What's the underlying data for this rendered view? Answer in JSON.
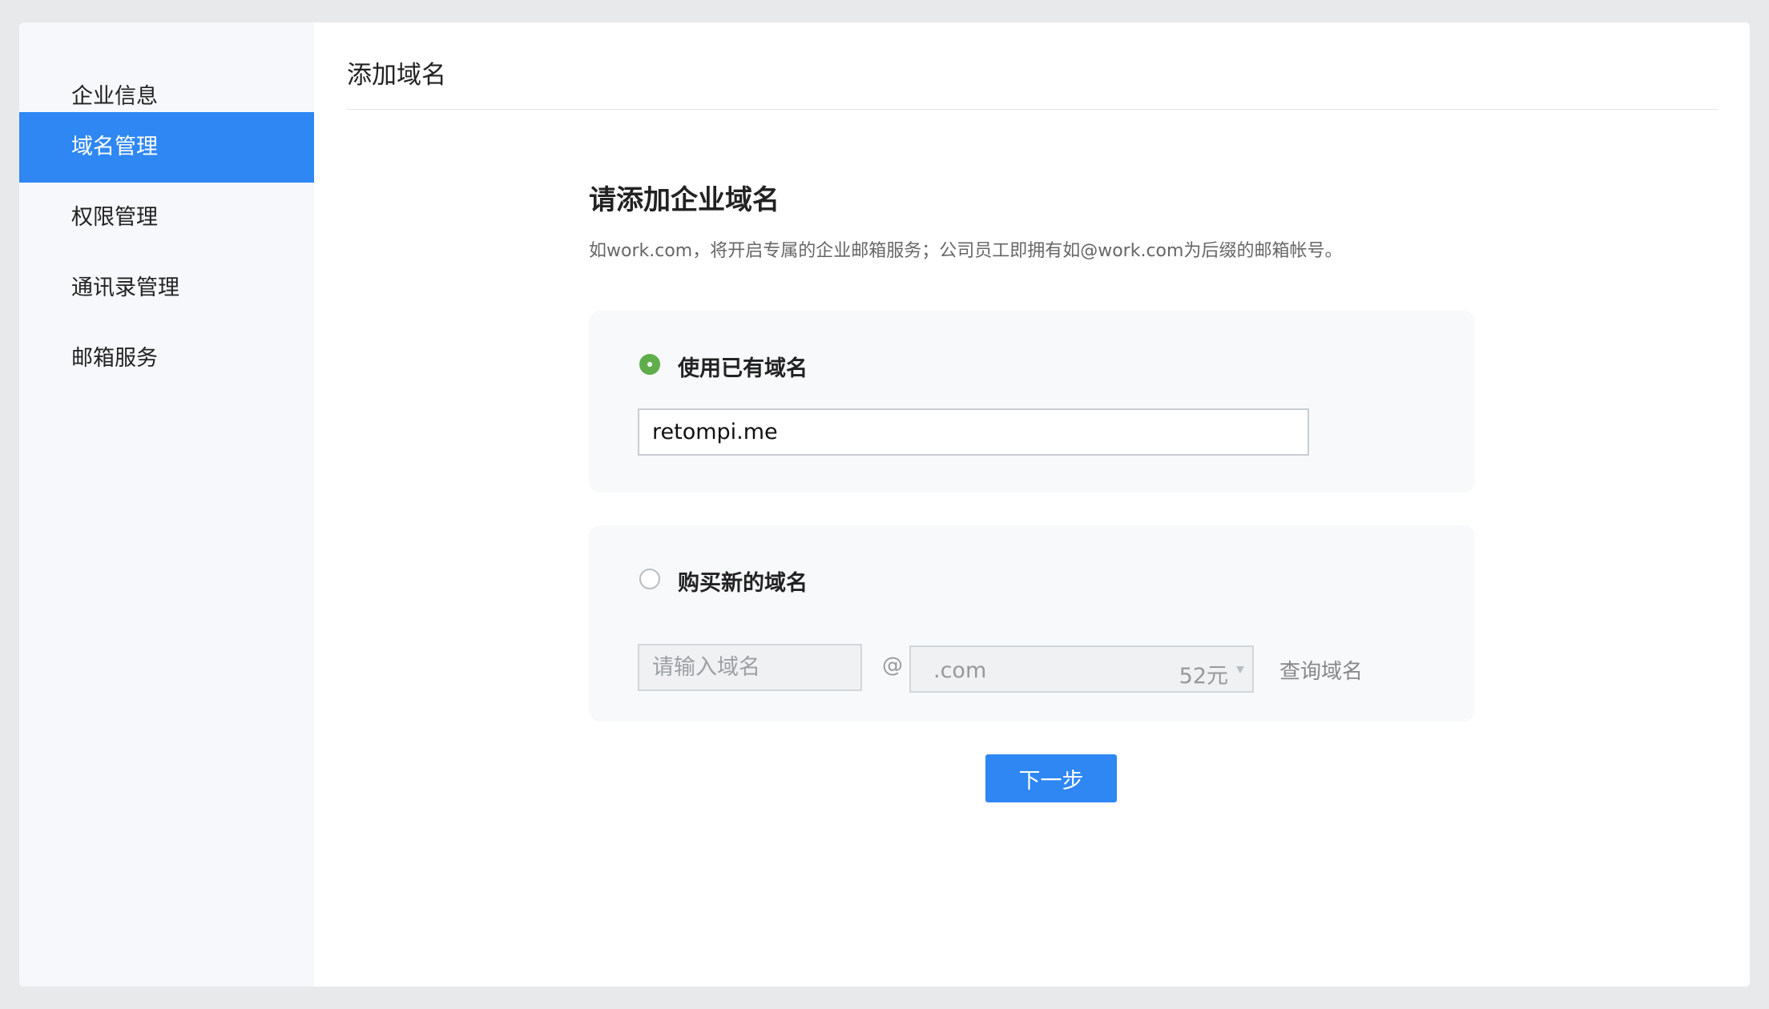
{
  "sidebar": {
    "items": [
      {
        "label": "企业信息",
        "active": false
      },
      {
        "label": "域名管理",
        "active": true
      },
      {
        "label": "权限管理",
        "active": false
      },
      {
        "label": "通讯录管理",
        "active": false
      },
      {
        "label": "邮箱服务",
        "active": false
      }
    ]
  },
  "main": {
    "title": "添加域名",
    "heading": "请添加企业域名",
    "description": "如work.com，将开启专属的企业邮箱服务；公司员工即拥有如@work.com为后缀的邮箱帐号。",
    "existing_option": {
      "label": "使用已有域名",
      "selected": true,
      "input_value": "retompi.me"
    },
    "buy_option": {
      "label": "购买新的域名",
      "selected": false,
      "input_placeholder": "请输入域名",
      "at_sign": "@",
      "tld_value": ".com",
      "tld_price": "52元",
      "query_label": "查询域名"
    },
    "next_label": "下一步"
  },
  "colors": {
    "accent": "#2e87f3",
    "radio_selected": "#5fae4b",
    "sidebar_bg": "#f6f8fb",
    "card_bg": "#f7f9fb",
    "page_bg": "#e8e9eb"
  }
}
